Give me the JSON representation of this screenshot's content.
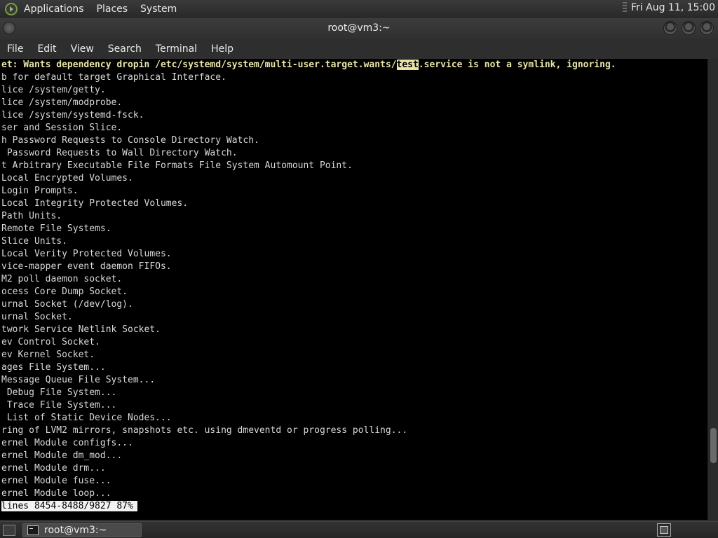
{
  "top_panel": {
    "menus": [
      "Applications",
      "Places",
      "System"
    ],
    "clock": "Fri Aug 11, 15:00"
  },
  "window": {
    "title": "root@vm3:~",
    "menus": [
      "File",
      "Edit",
      "View",
      "Search",
      "Terminal",
      "Help"
    ]
  },
  "terminal": {
    "warning_line": {
      "before": "et: Wants dependency dropin /etc/systemd/system/multi-user.target.wants/",
      "highlight": "test",
      "after": ".service is not a symlink, ignoring."
    },
    "lines": [
      "b for default target Graphical Interface.",
      "lice /system/getty.",
      "lice /system/modprobe.",
      "lice /system/systemd-fsck.",
      "ser and Session Slice.",
      "h Password Requests to Console Directory Watch.",
      " Password Requests to Wall Directory Watch.",
      "t Arbitrary Executable File Formats File System Automount Point.",
      "Local Encrypted Volumes.",
      "Login Prompts.",
      "Local Integrity Protected Volumes.",
      "Path Units.",
      "Remote File Systems.",
      "Slice Units.",
      "Local Verity Protected Volumes.",
      "vice-mapper event daemon FIFOs.",
      "M2 poll daemon socket.",
      "ocess Core Dump Socket.",
      "urnal Socket (/dev/log).",
      "urnal Socket.",
      "twork Service Netlink Socket.",
      "ev Control Socket.",
      "ev Kernel Socket.",
      "ages File System...",
      "Message Queue File System...",
      " Debug File System...",
      " Trace File System...",
      " List of Static Device Nodes...",
      "ring of LVM2 mirrors, snapshots etc. using dmeventd or progress polling...",
      "ernel Module configfs...",
      "ernel Module dm_mod...",
      "ernel Module drm...",
      "ernel Module fuse...",
      "ernel Module loop..."
    ],
    "status": "lines 8454-8488/9827 87%",
    "scroll_fraction": 0.87
  },
  "bottom_panel": {
    "task_label": "root@vm3:~"
  },
  "colors": {
    "warning_text": "#e8e4a8",
    "terminal_bg": "#000000",
    "terminal_fg": "#d9d9d9"
  }
}
